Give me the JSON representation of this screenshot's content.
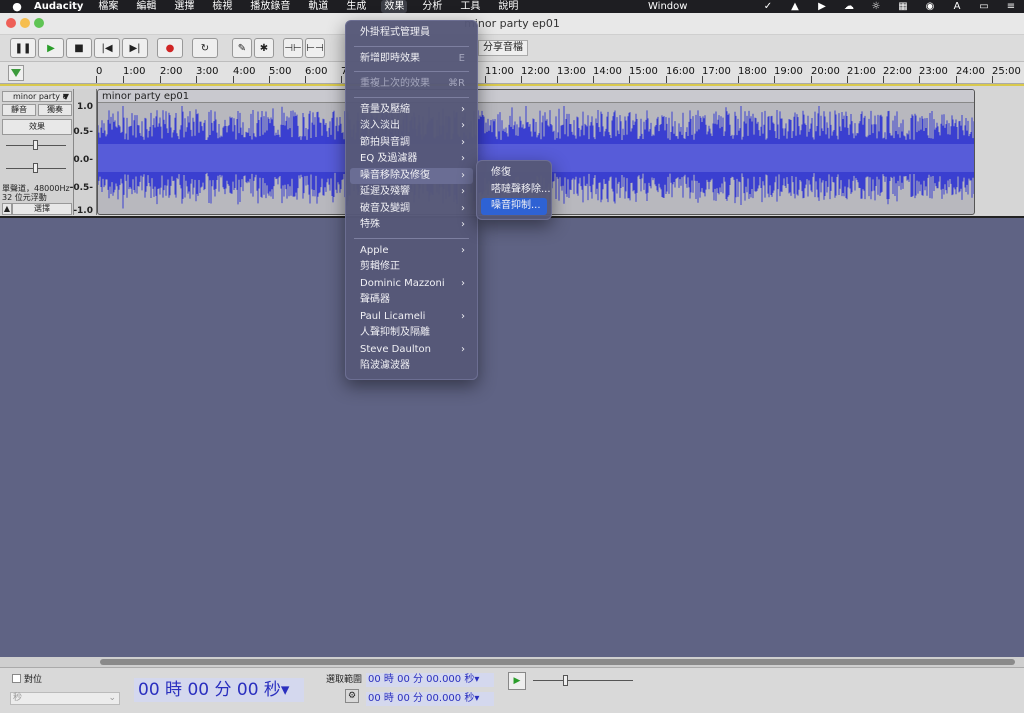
{
  "menubar": {
    "app": "Audacity",
    "items": [
      "檔案",
      "編輯",
      "選擇",
      "檢視",
      "播放錄音",
      "軌道",
      "生成",
      "效果",
      "分析",
      "工具",
      "說明"
    ],
    "active": "效果",
    "window_menu": "Window"
  },
  "window": {
    "title": "minor party ep01"
  },
  "toolbar": {
    "share_label": "分享音檔"
  },
  "ruler": {
    "ticks": [
      "0",
      "1:00",
      "2:00",
      "3:00",
      "4:00",
      "5:00",
      "6:00",
      "7",
      "11:00",
      "12:00",
      "13:00",
      "14:00",
      "15:00",
      "16:00",
      "17:00",
      "18:00",
      "19:00",
      "20:00",
      "21:00",
      "22:00",
      "23:00",
      "24:00",
      "25:00"
    ]
  },
  "track": {
    "name": "minor party e",
    "mute": "靜音",
    "solo": "獨奏",
    "effects": "效果",
    "info1": "單聲道，48000Hz",
    "info2": "32 位元浮動",
    "select": "選擇",
    "clip_title": "minor party ep01",
    "scale": [
      "1.0",
      "0.5-",
      "0.0-",
      "-0.5-",
      "-1.0"
    ]
  },
  "effect_menu": {
    "items": [
      {
        "label": "外掛程式管理員"
      },
      {
        "sep": true
      },
      {
        "label": "新增即時效果",
        "shortcut": "E"
      },
      {
        "sep": true
      },
      {
        "label": "重複上次的效果",
        "shortcut": "⌘R",
        "disabled": true
      },
      {
        "sep": true
      },
      {
        "label": "音量及壓縮",
        "sub": true
      },
      {
        "label": "淡入淡出",
        "sub": true
      },
      {
        "label": "節拍與音調",
        "sub": true
      },
      {
        "label": "EQ 及過濾器",
        "sub": true
      },
      {
        "label": "噪音移除及修復",
        "sub": true,
        "highlight": true
      },
      {
        "label": "延遲及殘響",
        "sub": true
      },
      {
        "label": "破音及變調",
        "sub": true
      },
      {
        "label": "特殊",
        "sub": true
      },
      {
        "sep": true
      },
      {
        "label": "Apple",
        "sub": true
      },
      {
        "label": "剪輯修正"
      },
      {
        "label": "Dominic Mazzoni",
        "sub": true
      },
      {
        "label": "聲碼器"
      },
      {
        "label": "Paul Licameli",
        "sub": true
      },
      {
        "label": "人聲抑制及隔離"
      },
      {
        "label": "Steve Daulton",
        "sub": true
      },
      {
        "label": "陷波濾波器"
      }
    ]
  },
  "submenu": {
    "items": [
      {
        "label": "修復"
      },
      {
        "label": "嗒噠聲移除..."
      },
      {
        "label": "噪音抑制...",
        "selected": true
      }
    ]
  },
  "bottom": {
    "snap": "對位",
    "unit": "秒",
    "big_time": "00 時 00 分 00 秒▾",
    "range_label": "選取範圍",
    "start_time": "00 時 00 分 00.000 秒▾",
    "end_time": "00 時 00 分 00.000 秒▾"
  },
  "colors": {
    "waveform": "#3a3fd0",
    "accent": "#2e62d4",
    "menu_bg": "#565878"
  }
}
